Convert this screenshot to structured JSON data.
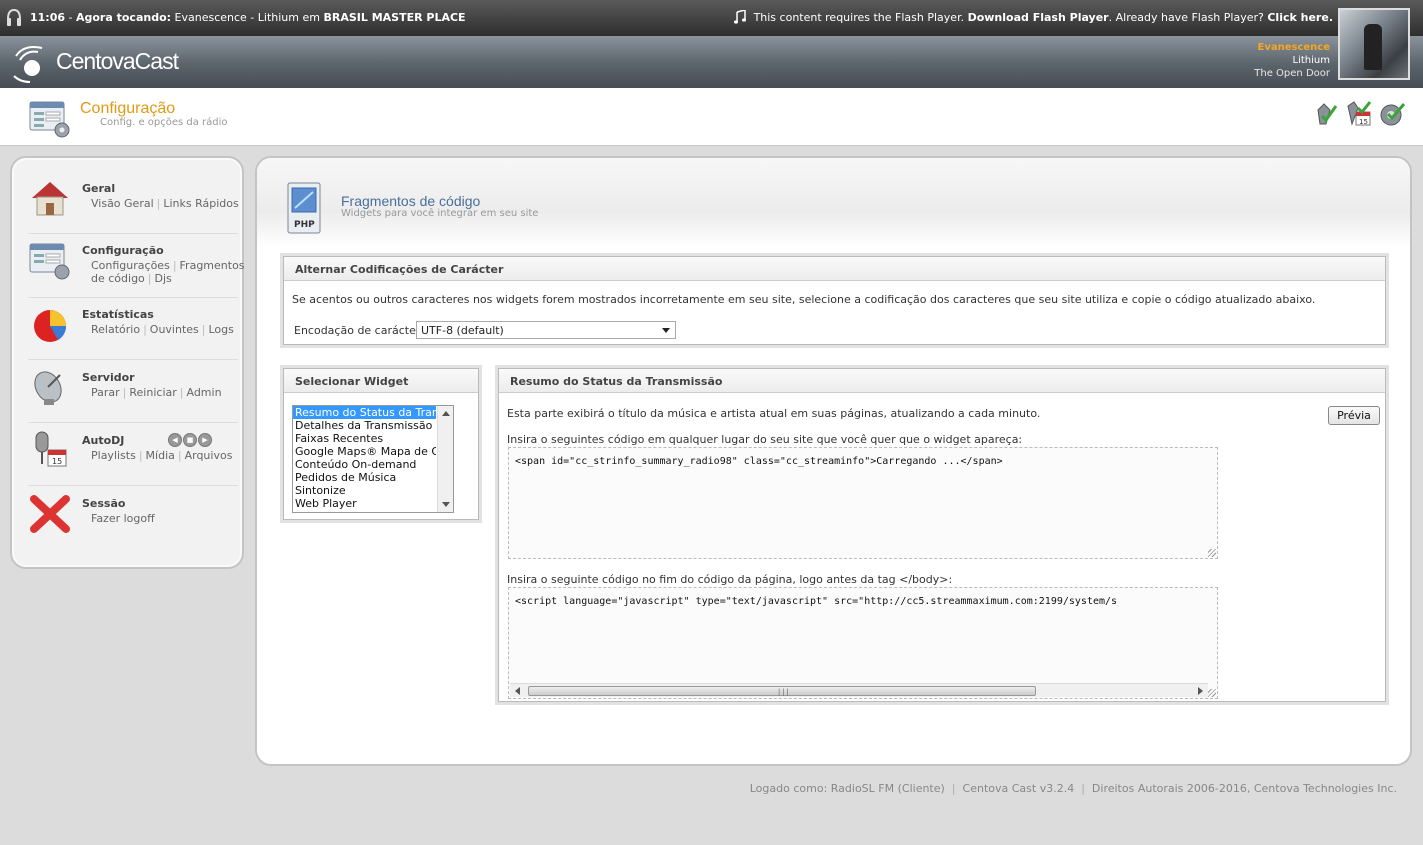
{
  "topbar": {
    "time": "11:06",
    "now_playing_label": "Agora tocando:",
    "track": "Evanescence - Lithium",
    "em": "em",
    "station": "BRASIL MASTER PLACE",
    "flash_msg": "This content requires the Flash Player.",
    "flash_download": "Download Flash Player",
    "flash_have": "Already have Flash Player?",
    "flash_click": "Click here."
  },
  "header": {
    "brand": "CentovaCast",
    "artist": "Evanescence",
    "title": "Lithium",
    "album": "The Open Door"
  },
  "page": {
    "title": "Configuração",
    "subtitle": "Config. e opções da rádio"
  },
  "sidebar": {
    "geral": {
      "title": "Geral",
      "links": [
        "Visão Geral",
        "Links Rápidos"
      ]
    },
    "config": {
      "title": "Configuração",
      "links": [
        "Configurações",
        "Fragmentos de código",
        "Djs"
      ]
    },
    "stats": {
      "title": "Estatísticas",
      "links": [
        "Relatório",
        "Ouvintes",
        "Logs"
      ]
    },
    "servidor": {
      "title": "Servidor",
      "links": [
        "Parar",
        "Reiniciar",
        "Admin"
      ]
    },
    "autodj": {
      "title": "AutoDJ",
      "links": [
        "Playlists",
        "Mídia",
        "Arquivos"
      ]
    },
    "sessao": {
      "title": "Sessão",
      "links": [
        "Fazer logoff"
      ]
    }
  },
  "section": {
    "title": "Fragmentos de código",
    "subtitle": "Widgets para você integrar em seu site",
    "icon_text": "PHP"
  },
  "encoding": {
    "header": "Alternar Codificações de Carácter",
    "description": "Se acentos ou outros caracteres nos widgets forem mostrados incorretamente em seu site, selecione a codificação dos caracteres que seu site utiliza e copie o código atualizado abaixo.",
    "label": "Encodação de carácter:",
    "selected": "UTF-8 (default)"
  },
  "widget": {
    "header": "Selecionar Widget",
    "options": [
      "Resumo do Status da Transmissão",
      "Detalhes da Transmissão",
      "Faixas Recentes",
      "Google Maps® Mapa de Ouvintes",
      "Conteúdo On-demand",
      "Pedidos de Música",
      "Sintonize",
      "Web Player"
    ],
    "selected_index": 0
  },
  "status": {
    "header": "Resumo do Status da Transmissão",
    "description": "Esta parte exibirá o título da música e artista atual em suas páginas, atualizando a cada minuto.",
    "preview_button": "Prévia",
    "label1": "Insira o seguintes código em qualquer lugar do seu site que você quer que o widget apareça:",
    "code1": "<span id=\"cc_strinfo_summary_radio98\" class=\"cc_streaminfo\">Carregando ...</span>",
    "label2": "Insira o seguinte código no fim do código da página, logo antes da tag </body>:",
    "code2": "<script language=\"javascript\" type=\"text/javascript\" src=\"http://cc5.streammaximum.com:2199/system/s"
  },
  "footer": {
    "logged": "Logado como: RadioSL FM (Cliente)",
    "version": "Centova Cast v3.2.4",
    "rights": "Direitos Autorais 2006-2016, Centova Technologies Inc."
  },
  "colors": {
    "accent": "#e29a12",
    "link_blue": "#4a6e9c",
    "selection": "#3399ff"
  }
}
